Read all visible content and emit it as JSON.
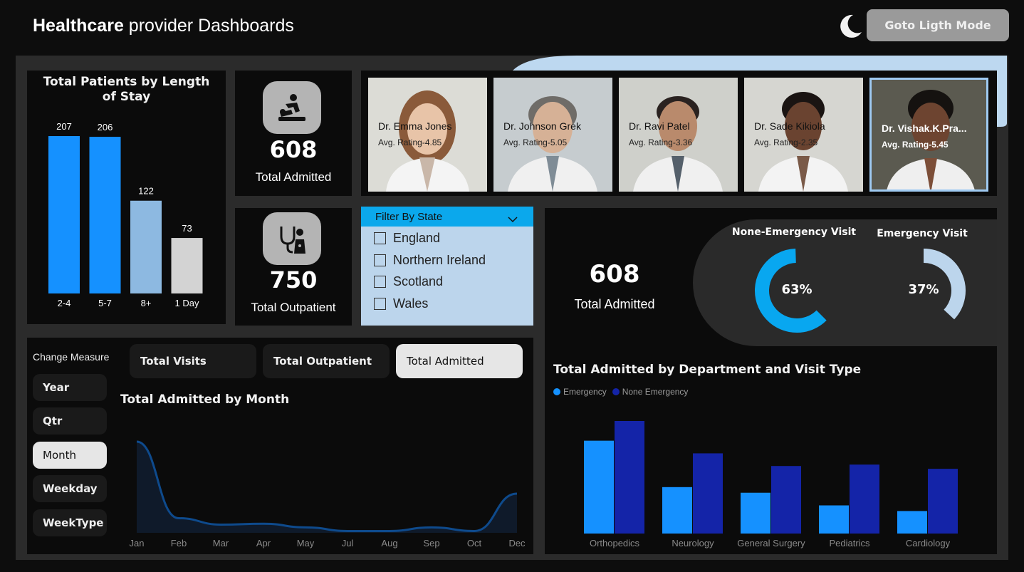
{
  "header": {
    "title_bold": "Healthcare",
    "title_rest": " provider Dashboards",
    "mode_button": "Goto Ligth Mode",
    "mode_icon": "moon-icon"
  },
  "los_chart": {
    "title": "Total Patients by Length of Stay"
  },
  "kpi_admitted": {
    "value": "608",
    "label": "Total Admitted",
    "icon": "patient-bed-icon"
  },
  "kpi_outpatient": {
    "value": "750",
    "label": "Total Outpatient",
    "icon": "stethoscope-icon"
  },
  "doctors": [
    {
      "name": "Dr. Emma Jones",
      "rating": "Avg. Rating-4.85"
    },
    {
      "name": "Dr. Johnson Grek",
      "rating": "Avg. Rating-5.05"
    },
    {
      "name": "Dr. Ravi Patel",
      "rating": "Avg. Rating-3.36"
    },
    {
      "name": "Dr. Sade Kikiola",
      "rating": "Avg. Rating-2.35"
    },
    {
      "name": "Dr. Vishak.K.Pra...",
      "rating": "Avg. Rating-5.45"
    }
  ],
  "state_filter": {
    "title": "Filter By State",
    "options": [
      "England",
      "Northern Ireland",
      "Scotland",
      "Wales"
    ]
  },
  "visit_panel": {
    "value": "608",
    "label": "Total Admitted",
    "non_emergency_title": "None-Emergency Visit",
    "emergency_title": "Emergency Visit",
    "non_emergency_pct": "63%",
    "emergency_pct": "37%"
  },
  "measure": {
    "title": "Change Measure",
    "buttons": [
      "Year",
      "Qtr",
      "Month",
      "Weekday",
      "WeekType"
    ],
    "active": "Month"
  },
  "tabs": {
    "items": [
      "Total Visits",
      "Total Outpatient",
      "Total Admitted"
    ],
    "active": "Total Admitted"
  },
  "monthly_chart": {
    "title": "Total Admitted by Month"
  },
  "dept_chart": {
    "title": "Total Admitted by Department and Visit Type",
    "legend": [
      "Emergency",
      "None Emergency"
    ]
  },
  "colors": {
    "accent_blue": "#1591ff",
    "light_blue": "#8db9e1",
    "grey_bar": "#d3d3d3",
    "navy": "#1424a8",
    "filter_bg": "#bcd5ec",
    "filter_header": "#0ba8ec",
    "donut_cyan": "#08a7f0"
  },
  "chart_data": [
    {
      "type": "bar",
      "title": "Total Patients by Length of Stay",
      "categories": [
        "2-4",
        "5-7",
        "8+",
        "1 Day"
      ],
      "values": [
        207,
        206,
        122,
        73
      ],
      "ylim": [
        0,
        207
      ]
    },
    {
      "type": "pie",
      "title": "",
      "categories": [
        "None-Emergency Visit",
        "Emergency Visit"
      ],
      "values": [
        63,
        37
      ]
    },
    {
      "type": "area",
      "title": "Total Admitted by Month",
      "categories": [
        "Jan",
        "Feb",
        "Mar",
        "Apr",
        "May",
        "Jul",
        "Aug",
        "Sep",
        "Oct",
        "Dec"
      ],
      "values": [
        100,
        16,
        9,
        10,
        6,
        2,
        2,
        6,
        2,
        43
      ],
      "ylim": [
        0,
        100
      ]
    },
    {
      "type": "bar",
      "title": "Total Admitted by Department and Visit Type",
      "categories": [
        "Orthopedics",
        "Neurology",
        "General Surgery",
        "Pediatrics",
        "Cardiology"
      ],
      "series": [
        {
          "name": "Emergency",
          "values": [
            66,
            33,
            29,
            20,
            16
          ]
        },
        {
          "name": "None Emergency",
          "values": [
            80,
            57,
            48,
            49,
            46
          ]
        }
      ],
      "ylim": [
        0,
        80
      ]
    }
  ]
}
